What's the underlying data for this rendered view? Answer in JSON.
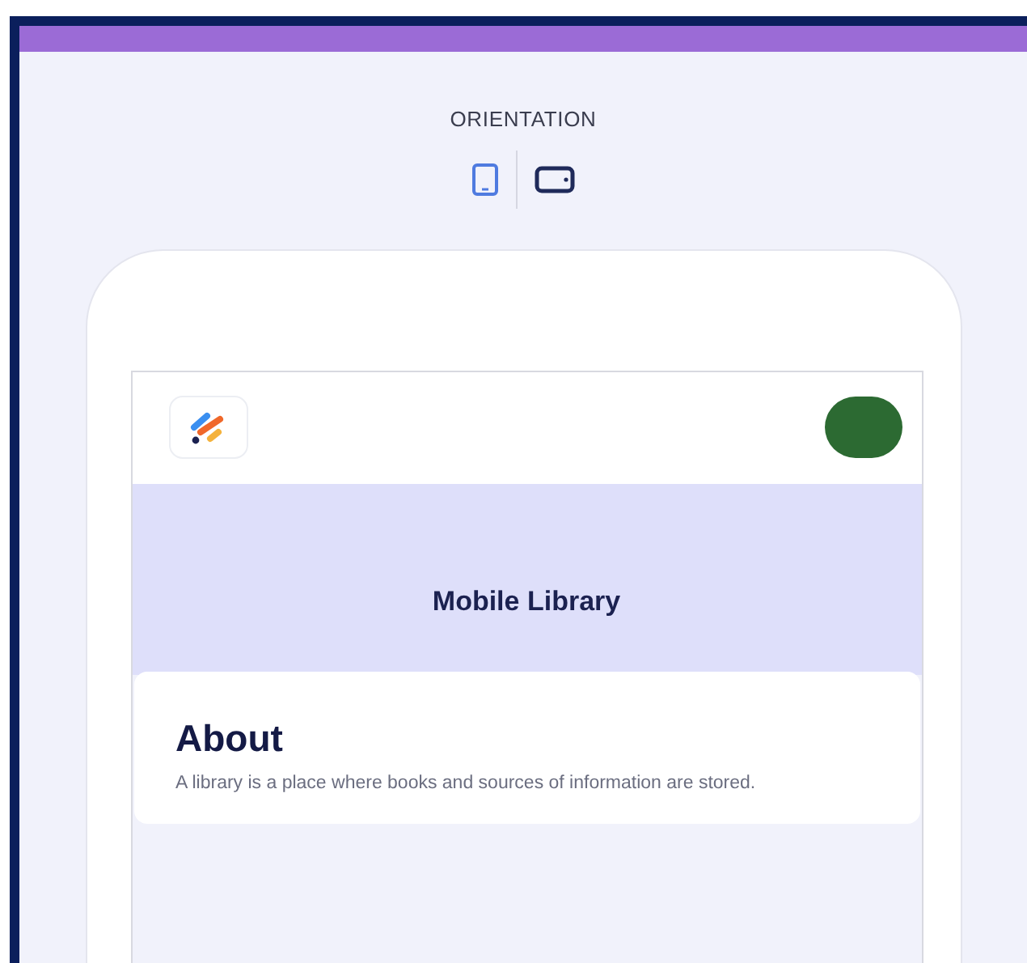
{
  "orientation": {
    "label": "ORIENTATION",
    "options": [
      {
        "kind": "portrait",
        "selected": true
      },
      {
        "kind": "landscape",
        "selected": false
      }
    ]
  },
  "preview": {
    "title": "Mobile Library",
    "about": {
      "heading": "About",
      "text": "A library is a place where books and sources of information are stored."
    }
  }
}
